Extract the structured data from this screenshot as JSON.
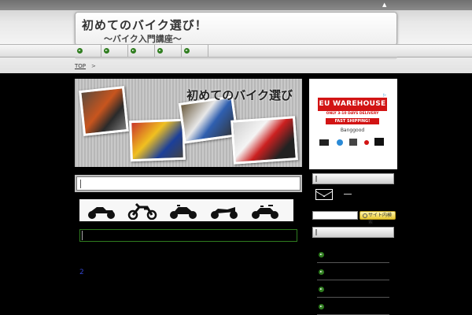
{
  "header": {
    "title": "初めてのバイク選び！",
    "subtitle": "～バイク入門講座～",
    "top_arrow": "▲"
  },
  "nav": {
    "items": [
      "",
      "",
      "",
      "",
      ""
    ]
  },
  "breadcrumb": {
    "home": "TOP",
    "separator": ">"
  },
  "banner": {
    "text": "初めてのバイク選び"
  },
  "main": {
    "small_text": "2"
  },
  "sidebar": {
    "ad": {
      "headline": "EU WAREHOUSE",
      "line": "ONLY 3-10 DAYS DELIVERY",
      "fast": "FAST SHIPPING!",
      "brand": "Banggood",
      "info_icon": "▷"
    },
    "search_button": "サイト内検索"
  },
  "colors": {
    "nav_dot": "#2f7d1f",
    "ad_red": "#d21414",
    "link_blue": "#3344cc"
  }
}
